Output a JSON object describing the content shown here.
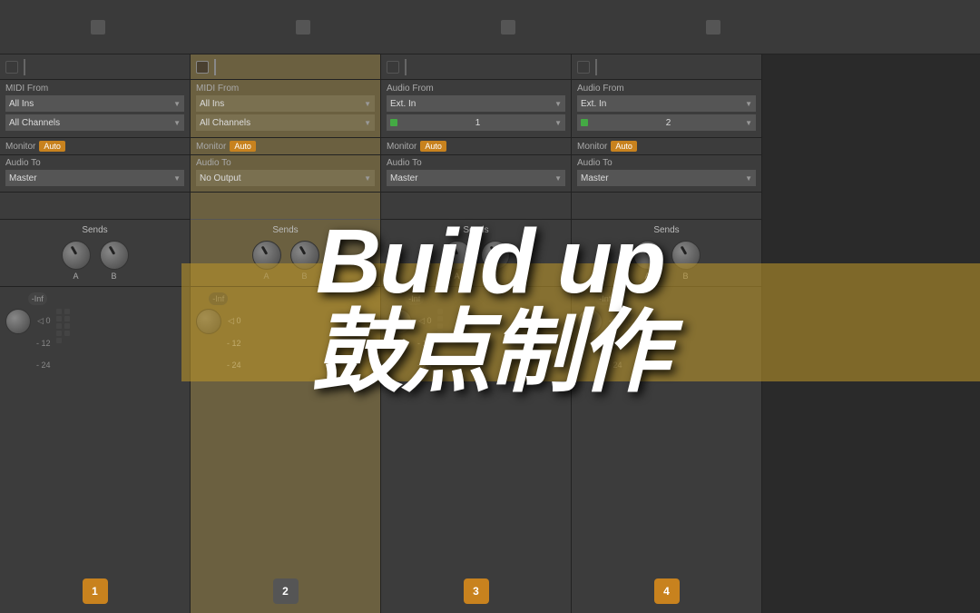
{
  "title": "Build up鼓点制作",
  "title_line1": "Build up",
  "title_line2": "鼓点制作",
  "timeline": {
    "height": 60
  },
  "channels": [
    {
      "id": 1,
      "type": "MIDI",
      "routing_label": "MIDI From",
      "source": "All Ins",
      "channel": "All Channels",
      "monitor_label": "Monitor",
      "monitor_mode": "Auto",
      "audio_to_label": "Audio To",
      "audio_to": "Master",
      "sends_label": "Sends",
      "send_a_label": "A",
      "send_b_label": "B",
      "db_label": "-Inf",
      "scale": [
        "0",
        "-12",
        "-24"
      ],
      "badge_num": "1",
      "badge_color": "orange",
      "highlighted": false
    },
    {
      "id": 2,
      "type": "MIDI",
      "routing_label": "MIDI From",
      "source": "All Ins",
      "channel": "All Channels",
      "monitor_label": "Monitor",
      "monitor_mode": "Auto",
      "audio_to_label": "Audio To",
      "audio_to": "No Output",
      "sends_label": "Sends",
      "send_a_label": "A",
      "send_b_label": "B",
      "db_label": "-Inf",
      "scale": [
        "0",
        "-12",
        "-24"
      ],
      "badge_num": "2",
      "badge_color": "dark",
      "highlighted": true
    },
    {
      "id": 3,
      "type": "Audio",
      "routing_label": "Audio From",
      "source": "Ext. In",
      "channel": "1",
      "monitor_label": "Monitor",
      "monitor_mode": "Auto",
      "audio_to_label": "Audio To",
      "audio_to": "Master",
      "sends_label": "Sends",
      "send_a_label": "A",
      "send_b_label": "B",
      "db_label": "-Inf",
      "scale": [
        "0",
        "-12",
        "-24"
      ],
      "badge_num": "3",
      "badge_color": "orange",
      "highlighted": false
    },
    {
      "id": 4,
      "type": "Audio",
      "routing_label": "Audio From",
      "source": "Ext. In",
      "channel": "2",
      "monitor_label": "Monitor",
      "monitor_mode": "Auto",
      "audio_to_label": "Audio To",
      "audio_to": "Master",
      "sends_label": "Sends",
      "send_a_label": "A",
      "send_b_label": "B",
      "db_label": "-Inf",
      "scale": [
        "0",
        "-12",
        "-24"
      ],
      "badge_num": "4",
      "badge_color": "orange",
      "highlighted": false
    }
  ]
}
